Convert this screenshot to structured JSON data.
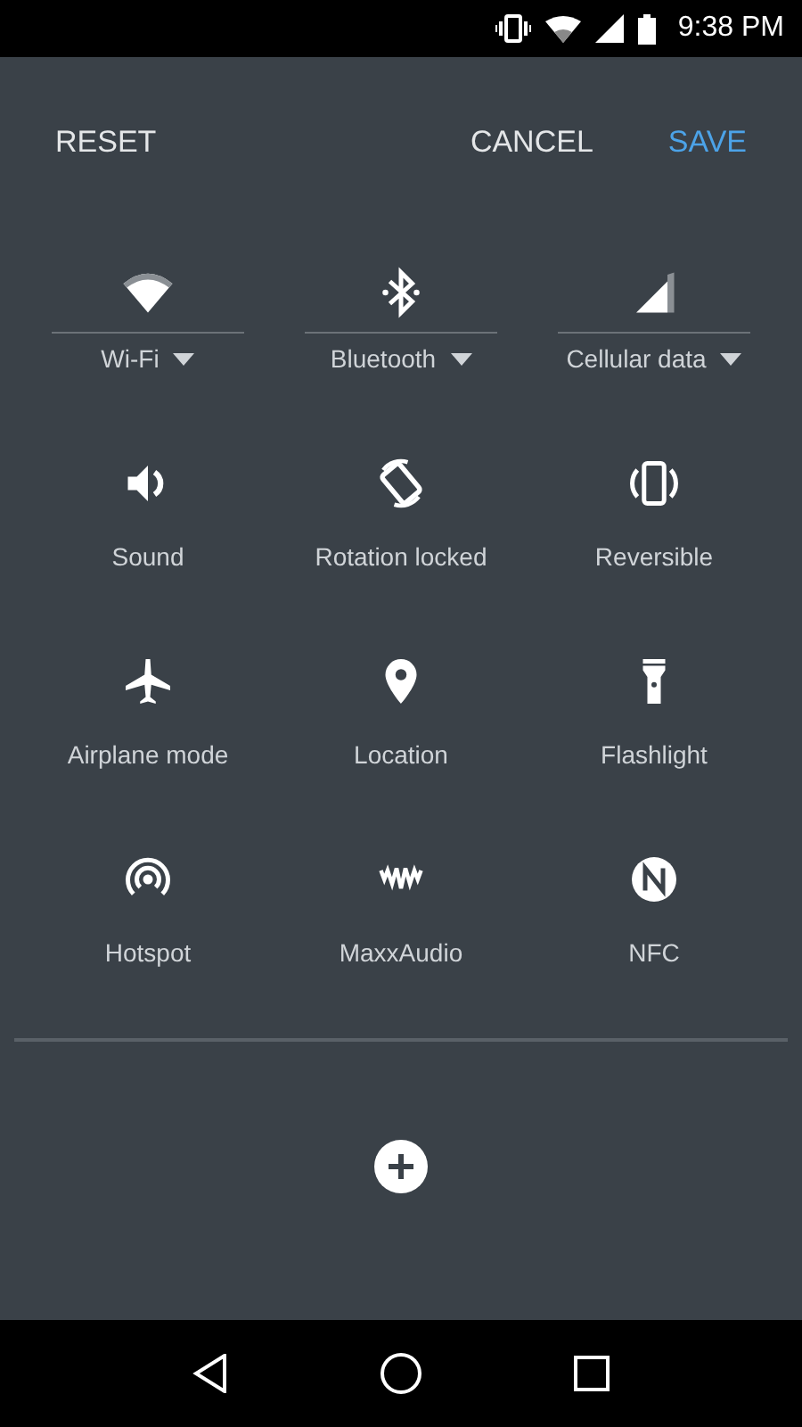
{
  "status_bar": {
    "time": "9:38 PM"
  },
  "header": {
    "reset": "RESET",
    "cancel": "CANCEL",
    "save": "SAVE"
  },
  "tiles": [
    {
      "kind": "detail",
      "label": "Wi-Fi"
    },
    {
      "kind": "detail",
      "label": "Bluetooth"
    },
    {
      "kind": "detail",
      "label": "Cellular data"
    },
    {
      "kind": "simple",
      "label": "Sound"
    },
    {
      "kind": "simple",
      "label": "Rotation locked"
    },
    {
      "kind": "simple",
      "label": "Reversible"
    },
    {
      "kind": "simple",
      "label": "Airplane mode"
    },
    {
      "kind": "simple",
      "label": "Location"
    },
    {
      "kind": "simple",
      "label": "Flashlight"
    },
    {
      "kind": "simple",
      "label": "Hotspot"
    },
    {
      "kind": "simple",
      "label": "MaxxAudio"
    },
    {
      "kind": "simple",
      "label": "NFC"
    }
  ]
}
